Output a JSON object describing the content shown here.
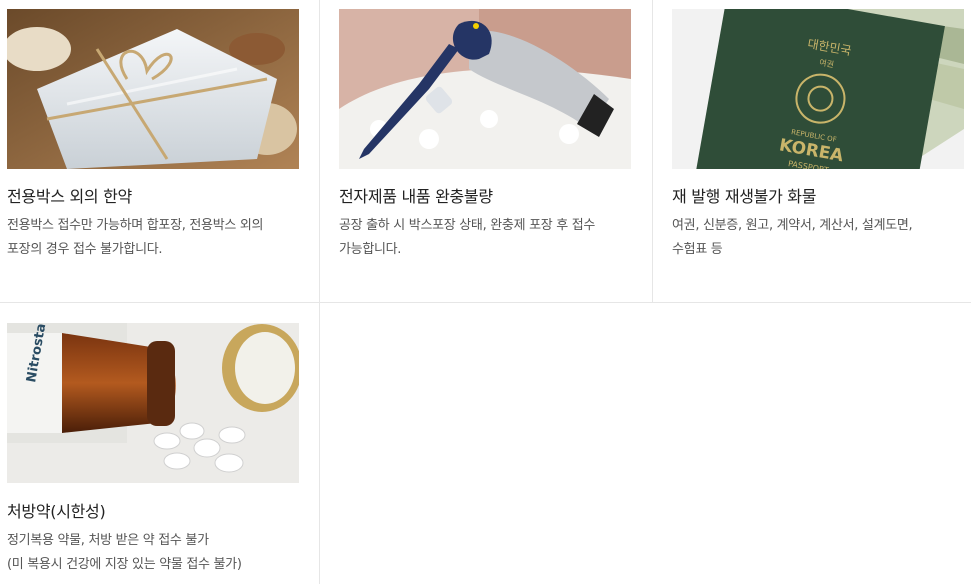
{
  "items": [
    {
      "title": "전용박스 외의 한약",
      "description": "전용박스 접수만 가능하며 합포장, 전용박스 외의\n포장의 경우 접수 불가합니다.",
      "image_icon": "herbal-medicine-package"
    },
    {
      "title": "전자제품 내품 완충불량",
      "description": "공장 출하 시 박스포장 상태, 완충제 포장 후 접수\n가능합니다.",
      "image_icon": "hair-dryer-in-box"
    },
    {
      "title": "재 발행 재생불가 화물",
      "description": "여권, 신분증, 원고, 계약서, 계산서, 설계도면,\n수험표 등",
      "image_icon": "passport-and-money",
      "passport_text": {
        "country_ko": "대한민국",
        "type_ko": "여권",
        "republic": "REPUBLIC OF",
        "country": "KOREA",
        "pass": "PASSPORT"
      }
    },
    {
      "title": "처방약(시한성)",
      "description": "정기복용 약물, 처방 받은 약 접수 불가\n(미 복용시 건강에 지장 있는 약물 접수 불가)",
      "image_icon": "medicine-bottle-pills",
      "bottle_label": "Nitrostat"
    }
  ]
}
